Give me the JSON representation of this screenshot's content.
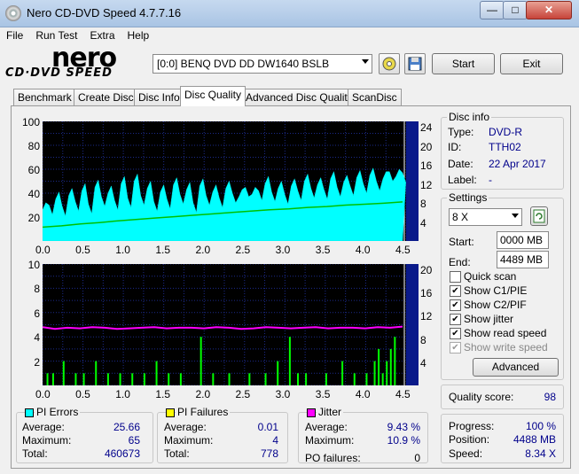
{
  "window": {
    "title": "Nero CD-DVD Speed 4.7.7.16",
    "min_label": "—",
    "max_label": "□",
    "close_label": "✕"
  },
  "menu": [
    "File",
    "Run Test",
    "Extra",
    "Help"
  ],
  "logo": {
    "main": "nero",
    "sub": "CD·DVD SPEED"
  },
  "drive": {
    "selected": "[0:0]   BENQ DVD DD DW1640 BSLB"
  },
  "buttons": {
    "start": "Start",
    "exit": "Exit",
    "advanced": "Advanced"
  },
  "tabs": [
    "Benchmark",
    "Create Disc",
    "Disc Info",
    "Disc Quality",
    "Advanced Disc Quality",
    "ScanDisc"
  ],
  "active_tab": "Disc Quality",
  "disc_info": {
    "title": "Disc info",
    "type_label": "Type:",
    "type": "DVD-R",
    "id_label": "ID:",
    "id": "TTH02",
    "date_label": "Date:",
    "date": "22 Apr 2017",
    "label_label": "Label:",
    "label": "-"
  },
  "settings": {
    "title": "Settings",
    "speed": "8 X",
    "start_label": "Start:",
    "start": "0000 MB",
    "end_label": "End:",
    "end": "4489 MB",
    "checkboxes": [
      {
        "label": "Quick scan",
        "checked": false,
        "enabled": true
      },
      {
        "label": "Show C1/PIE",
        "checked": true,
        "enabled": true
      },
      {
        "label": "Show C2/PIF",
        "checked": true,
        "enabled": true
      },
      {
        "label": "Show jitter",
        "checked": true,
        "enabled": true
      },
      {
        "label": "Show read speed",
        "checked": true,
        "enabled": true
      },
      {
        "label": "Show write speed",
        "checked": true,
        "enabled": false
      }
    ]
  },
  "quality": {
    "label": "Quality score:",
    "value": "98"
  },
  "progress": {
    "progress_label": "Progress:",
    "progress": "100 %",
    "position_label": "Position:",
    "position": "4488 MB",
    "speed_label": "Speed:",
    "speed": "8.34 X"
  },
  "stats": {
    "pi_errors": {
      "title": "PI Errors",
      "avg_label": "Average:",
      "avg": "25.66",
      "max_label": "Maximum:",
      "max": "65",
      "total_label": "Total:",
      "total": "460673",
      "color": "#00ffff"
    },
    "pi_failures": {
      "title": "PI Failures",
      "avg_label": "Average:",
      "avg": "0.01",
      "max_label": "Maximum:",
      "max": "4",
      "total_label": "Total:",
      "total": "778",
      "color": "#ffff00"
    },
    "jitter": {
      "title": "Jitter",
      "avg_label": "Average:",
      "avg": "9.43 %",
      "max_label": "Maximum:",
      "max": "10.9 %",
      "po_label": "PO failures:",
      "po": "0",
      "color": "#ff00ff"
    }
  },
  "chart_data": [
    {
      "type": "area",
      "name": "pi-errors-chart",
      "x_ticks": [
        "0.0",
        "0.5",
        "1.0",
        "1.5",
        "2.0",
        "2.5",
        "3.0",
        "3.5",
        "4.0",
        "4.5"
      ],
      "y_left_ticks": [
        "100",
        "80",
        "60",
        "40",
        "20"
      ],
      "y_right_ticks": [
        "24",
        "20",
        "16",
        "12",
        "8",
        "4"
      ],
      "xlim": [
        0,
        4.5
      ],
      "ylim": [
        0,
        100
      ],
      "y2lim": [
        0,
        26
      ],
      "series": [
        {
          "values": [
            26,
            30,
            35,
            29,
            38,
            33,
            42,
            31,
            45,
            37,
            40,
            34,
            48,
            36,
            50,
            38,
            44,
            33,
            41,
            35,
            47,
            39,
            43,
            32,
            46,
            38,
            41,
            36,
            44,
            40,
            37,
            45,
            39,
            42,
            48,
            41,
            44,
            39,
            46,
            42,
            50,
            44,
            47,
            43,
            52,
            45,
            49,
            46,
            53,
            48,
            55,
            50,
            52,
            58,
            54,
            57
          ]
        },
        {
          "values": [
            3.0,
            3.3,
            3.7,
            4.0,
            4.4,
            4.7,
            5.0,
            5.3,
            5.6,
            5.9,
            6.2,
            6.5,
            6.8,
            7.0,
            7.3,
            7.5,
            7.8,
            8.0,
            8.2,
            8.5
          ]
        }
      ],
      "grid": true
    },
    {
      "type": "bar",
      "name": "pi-failures-chart",
      "x_ticks": [
        "0.0",
        "0.5",
        "1.0",
        "1.5",
        "2.0",
        "2.5",
        "3.0",
        "3.5",
        "4.0",
        "4.5"
      ],
      "y_left_ticks": [
        "10",
        "8",
        "6",
        "4",
        "2"
      ],
      "y_right_ticks": [
        "20",
        "16",
        "12",
        "8",
        "4"
      ],
      "xlim": [
        0,
        4.5
      ],
      "ylim": [
        0,
        10
      ],
      "y2lim": [
        0,
        20
      ],
      "series": [
        {
          "x": [
            0.05,
            0.12,
            0.25,
            0.4,
            0.5,
            0.65,
            0.8,
            0.95,
            1.1,
            1.25,
            1.4,
            1.55,
            1.7,
            1.95,
            2.1,
            2.3,
            2.55,
            2.75,
            2.9,
            3.05,
            3.15,
            3.25,
            3.5,
            3.7,
            3.85,
            4.0,
            4.1,
            4.15,
            4.2,
            4.25,
            4.3,
            4.35
          ],
          "values": [
            1,
            1,
            2,
            1,
            1,
            2,
            1,
            1,
            1,
            1,
            2,
            1,
            1,
            4,
            1,
            1,
            1,
            1,
            2,
            4,
            1,
            1,
            1,
            2,
            1,
            1,
            2,
            3,
            1,
            2,
            3,
            4
          ]
        },
        {
          "values": [
            9.6,
            9.3,
            9.5,
            9.4,
            9.6,
            9.5,
            9.3,
            9.4,
            9.5,
            9.6,
            9.4,
            9.5,
            9.5,
            9.4,
            9.6,
            9.5,
            9.3,
            9.4,
            9.6,
            9.5,
            9.4,
            9.5,
            9.6,
            9.4,
            9.5,
            9.5,
            9.4,
            9.6,
            9.5,
            9.7
          ]
        }
      ],
      "grid": true
    }
  ]
}
